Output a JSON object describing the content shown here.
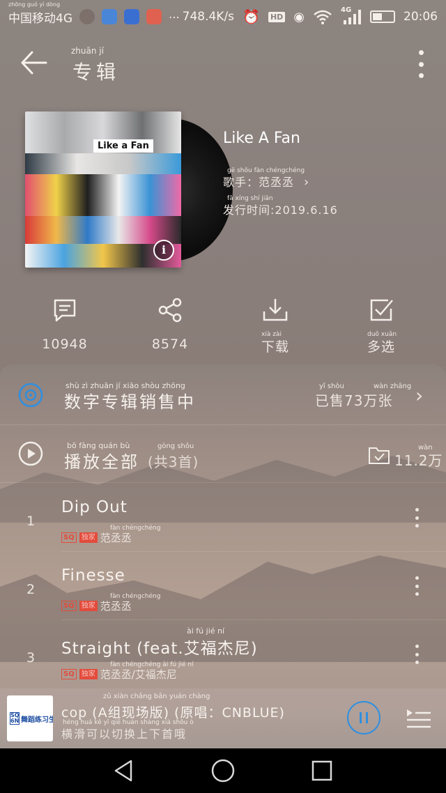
{
  "status_bar": {
    "carrier": "中国移动4G",
    "carrier_pinyin": "zhōng guó  yí  dòng",
    "speed": "748.4K/s",
    "network": "4G",
    "hd": "HD",
    "time": "20:06"
  },
  "header": {
    "title": "专辑",
    "title_pinyin": "zhuān   jí"
  },
  "album": {
    "cover_title": "Like a Fan",
    "cover_info_glyph": "i",
    "name": "Like A Fan",
    "artist_line": "歌手：范丞丞",
    "artist_pinyin": "gē  shǒu        fàn chéngchéng",
    "release_line": "发行时间:2019.6.16",
    "release_pinyin": "fā  xíng  shí  jiān"
  },
  "actions": [
    {
      "name": "comment",
      "label": "10948"
    },
    {
      "name": "share",
      "label": "8574"
    },
    {
      "name": "download",
      "label": "下载",
      "pinyin": "xià   zài"
    },
    {
      "name": "multiselect",
      "label": "多选",
      "pinyin": "duō  xuǎn"
    }
  ],
  "digital_sale": {
    "title": "数字专辑销售中",
    "title_pinyin": "shù    zì   zhuān    jí    xiāo  shòu  zhōng",
    "sold": "已售73万张",
    "sold_pinyin_left": "yǐ    shòu",
    "sold_pinyin_right": "wàn zhāng"
  },
  "play_all": {
    "title": "播放全部",
    "title_pinyin": "bō   fàng  quán   bù",
    "count": "(共3首)",
    "count_pinyin": "gòng       shǒu",
    "favorites": "11.2万",
    "favorites_pinyin": "wàn"
  },
  "songs": [
    {
      "num": "1",
      "title": "Dip Out",
      "sq": "SQ",
      "exclusive": "独家",
      "artist": "范丞丞",
      "artist_pinyin": "fàn chéngchéng"
    },
    {
      "num": "2",
      "title": "Finesse",
      "sq": "SQ",
      "exclusive": "独家",
      "artist": "范丞丞",
      "artist_pinyin": "fàn chéngchéng"
    },
    {
      "num": "3",
      "title": "Straight (feat.艾福杰尼)",
      "title_pinyin": "ài    fú    jié   ní",
      "sq": "SQ",
      "exclusive": "独家",
      "artist": "范丞丞/艾福杰尼",
      "artist_pinyin": "fàn chéngchéng    ài   fú   jié   ní"
    }
  ],
  "mini_player": {
    "thumb_logo": "SQ 6N",
    "thumb_text": "舞蹈练习生",
    "title": "cop (A组现场版) (原唱：CNBLUE)",
    "title_pinyin": "zǔ  xiàn chǎng bǎn              yuán chàng",
    "hint": "横滑可以切换上下首哦",
    "hint_pinyin": "héng  huá   kě    yǐ   qiē  huàn shàng  xià  shǒu   ò"
  }
}
